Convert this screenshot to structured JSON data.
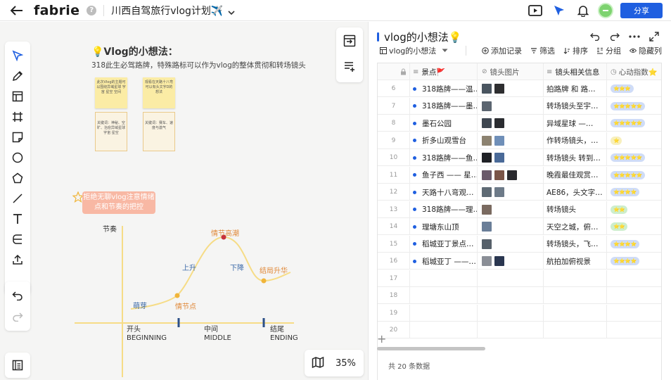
{
  "app": {
    "brand": "fabrie",
    "help": "?",
    "doc_title": "川西自驾旅行vlog计划✈️",
    "share_label": "分享"
  },
  "canvas": {
    "zoom": "35%",
    "idea_title": "💡Vlog的小想法：",
    "idea_subtitle": "318此生必驾路牌，特殊路标可以作为vlog的整体贯彻和转场镜头",
    "stickies": [
      "此次Vlog的主题可以围绕异域星球 宇宙 星空 空间",
      "观看在天路十八弯可以有头文字D的想法"
    ],
    "frames": [
      "关键词：神秘、空旷、治愈异域星球 宇宙 星空",
      "关键词：赛车、速度与激气"
    ],
    "tag_text": "拒绝无聊vlog注意情绪点和节奏的把控",
    "rhythm": {
      "axis": "节奏",
      "labels": {
        "sprout": "萌芽",
        "plot_point": "情节点",
        "rise": "上升",
        "climax": "情节高潮",
        "fall": "下降",
        "ending_rise": "结局升华"
      },
      "stages": [
        {
          "cn": "开头",
          "en": "BEGINNING"
        },
        {
          "cn": "中间",
          "en": "MIDDLE"
        },
        {
          "cn": "结尾",
          "en": "ENDING"
        }
      ]
    }
  },
  "panel": {
    "title": "vlog的小想法💡",
    "view_name": "vlog的小想法",
    "actions": [
      "添加记录",
      "筛选",
      "排序",
      "分组",
      "隐藏列"
    ],
    "columns": [
      "景点🚩",
      "镜头图片",
      "镜头相关信息",
      "心动指数⭐"
    ],
    "rows": [
      {
        "num": "6",
        "name": "318路牌——温…",
        "desc": "拍路牌 和 路…",
        "stars": "⭐⭐⭐",
        "pill": "blue",
        "thumbs": [
          "#4a5560",
          "#2e2e30"
        ]
      },
      {
        "num": "7",
        "name": "318路牌——墨…",
        "desc": "转场镜头至宇…",
        "stars": "⭐⭐⭐⭐⭐",
        "pill": "blue",
        "thumbs": [
          "#5b6570"
        ]
      },
      {
        "num": "8",
        "name": "墨石公园",
        "desc": "异域星球 —…",
        "stars": "⭐⭐⭐⭐⭐",
        "pill": "blue",
        "thumbs": [
          "#3e4650",
          "#2a2c30"
        ]
      },
      {
        "num": "9",
        "name": "折多山观雪台",
        "desc": "作转场镜头，…",
        "stars": "⭐",
        "pill": "yellow",
        "thumbs": [
          "#8c8270",
          "#6f8fb8"
        ]
      },
      {
        "num": "10",
        "name": "318路牌——鱼…",
        "desc": "转场镜头 转到…",
        "stars": "⭐⭐⭐⭐⭐",
        "pill": "blue",
        "thumbs": [
          "#1f2126",
          "#4a6a98"
        ]
      },
      {
        "num": "11",
        "name": "鱼子西 —— 星…",
        "desc": "晚霞最佳观赏…",
        "stars": "⭐⭐⭐⭐⭐",
        "pill": "blue",
        "thumbs": [
          "#6a5a6a",
          "#7a5548",
          "#2a2a2e"
        ]
      },
      {
        "num": "12",
        "name": "天路十八弯观…",
        "desc": "AE86，头文字…",
        "stars": "⭐⭐⭐⭐",
        "pill": "blue",
        "thumbs": [
          "#5e6a74",
          "#6d7a88"
        ]
      },
      {
        "num": "13",
        "name": "318路牌——理…",
        "desc": "转场镜头",
        "stars": "⭐⭐",
        "pill": "green",
        "thumbs": [
          "#7a6a60"
        ]
      },
      {
        "num": "14",
        "name": "理塘东山顶",
        "desc": "天空之城，俯…",
        "stars": "⭐⭐",
        "pill": "green",
        "thumbs": [
          "#6a7e98"
        ]
      },
      {
        "num": "15",
        "name": "稻城亚丁景点…",
        "desc": "转场镜头，飞…",
        "stars": "⭐⭐⭐⭐",
        "pill": "blue",
        "thumbs": [
          "#56606a"
        ]
      },
      {
        "num": "16",
        "name": "稻城亚丁 ——…",
        "desc": "航拍加俯视景",
        "stars": "⭐⭐⭐⭐",
        "pill": "blue",
        "thumbs": [
          "#8a8e96",
          "#2a3650"
        ]
      },
      {
        "num": "17",
        "name": "",
        "desc": "",
        "stars": "",
        "pill": "",
        "thumbs": []
      },
      {
        "num": "18",
        "name": "",
        "desc": "",
        "stars": "",
        "pill": "",
        "thumbs": []
      },
      {
        "num": "19",
        "name": "",
        "desc": "",
        "stars": "",
        "pill": "",
        "thumbs": []
      },
      {
        "num": "20",
        "name": "",
        "desc": "",
        "stars": "",
        "pill": "",
        "thumbs": []
      }
    ],
    "add_row": "+",
    "count_text": "共 20 条数据"
  },
  "colors": {
    "accent": "#1f5fe0",
    "curve": "#f6dc86",
    "climax_dot": "#c7323c",
    "point_dot": "#f0b53a"
  }
}
